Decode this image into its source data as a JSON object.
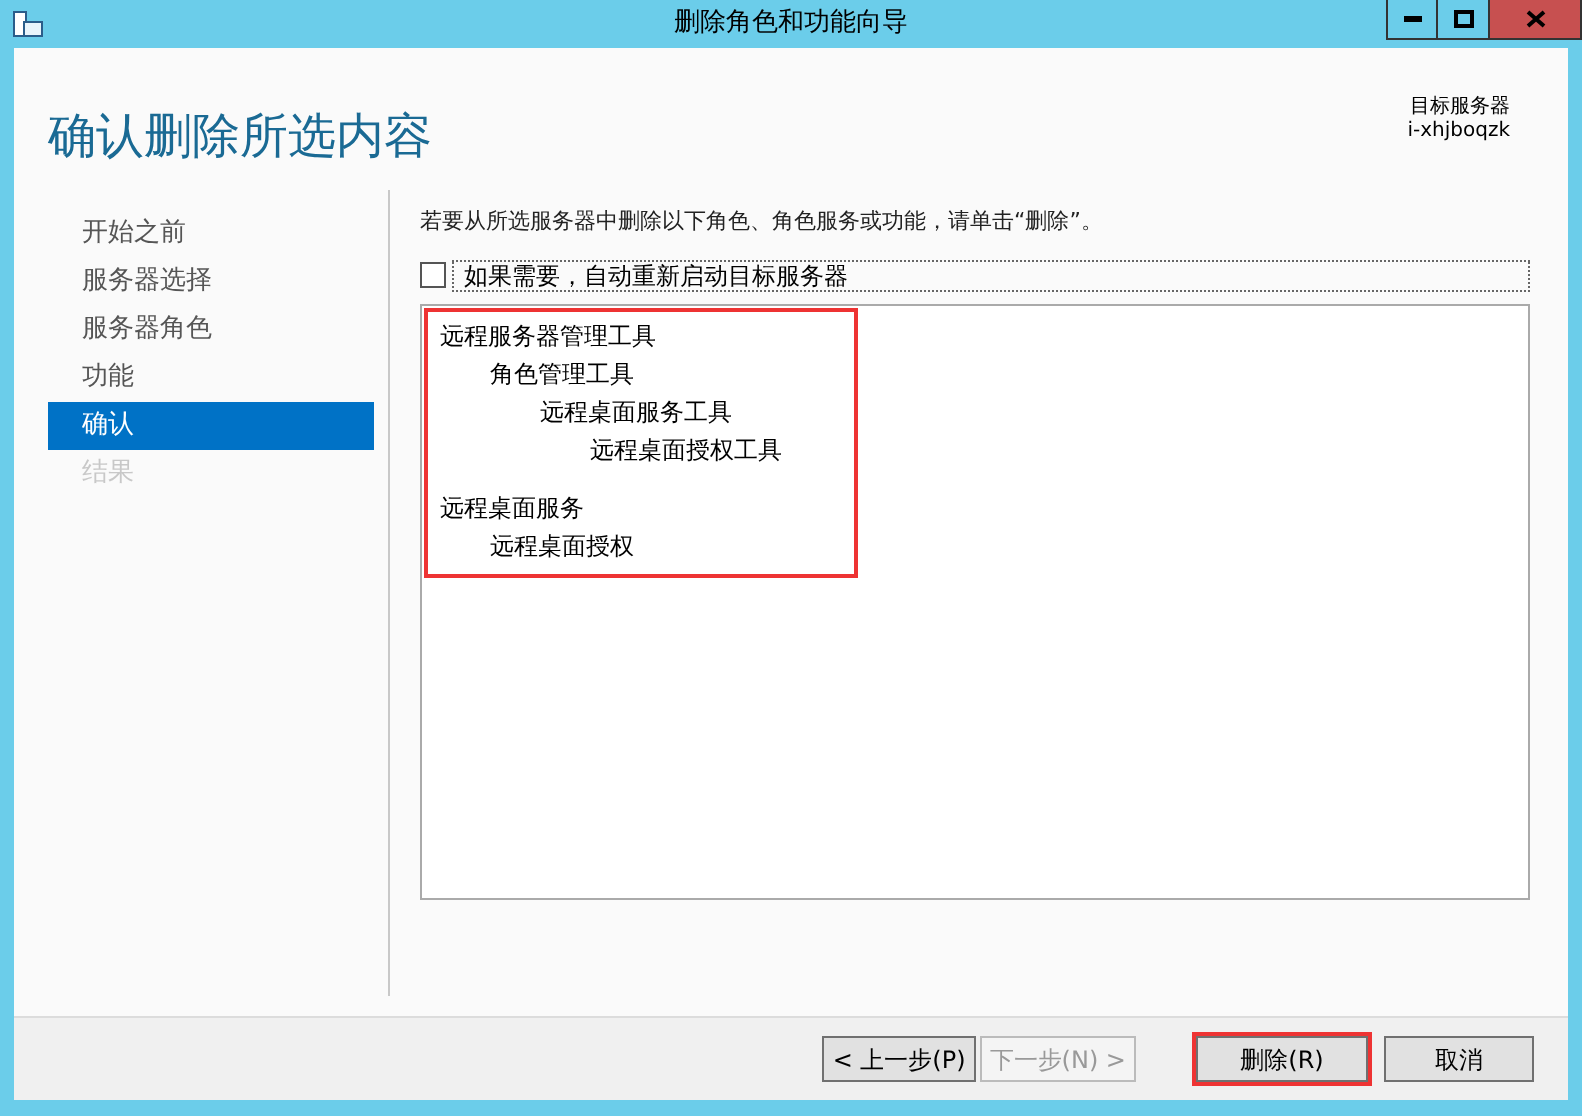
{
  "window": {
    "title": "删除角色和功能向导"
  },
  "header": {
    "title": "确认删除所选内容",
    "target_label": "目标服务器",
    "target_value": "i-xhjboqzk"
  },
  "sidebar": {
    "items": [
      {
        "label": "开始之前",
        "selected": false,
        "disabled": false
      },
      {
        "label": "服务器选择",
        "selected": false,
        "disabled": false
      },
      {
        "label": "服务器角色",
        "selected": false,
        "disabled": false
      },
      {
        "label": "功能",
        "selected": false,
        "disabled": false
      },
      {
        "label": "确认",
        "selected": true,
        "disabled": false
      },
      {
        "label": "结果",
        "selected": false,
        "disabled": true
      }
    ]
  },
  "main": {
    "instruction": "若要从所选服务器中删除以下角色、角色服务或功能，请单击“删除”。",
    "restart_checkbox": {
      "label": "如果需要，自动重新启动目标服务器",
      "checked": false
    },
    "removal_list": {
      "highlighted": true,
      "groups": [
        {
          "label": "远程服务器管理工具",
          "children": [
            {
              "label": "角色管理工具",
              "children": [
                {
                  "label": "远程桌面服务工具",
                  "children": [
                    {
                      "label": "远程桌面授权工具"
                    }
                  ]
                }
              ]
            }
          ]
        },
        {
          "label": "远程桌面服务",
          "children": [
            {
              "label": "远程桌面授权"
            }
          ]
        }
      ]
    }
  },
  "buttons": [
    {
      "label": "< 上一步(P)",
      "disabled": false,
      "highlighted": false
    },
    {
      "label": "下一步(N) >",
      "disabled": true,
      "highlighted": false
    },
    {
      "label": "删除(R)",
      "disabled": false,
      "highlighted": true
    },
    {
      "label": "取消",
      "disabled": false,
      "highlighted": false
    }
  ]
}
